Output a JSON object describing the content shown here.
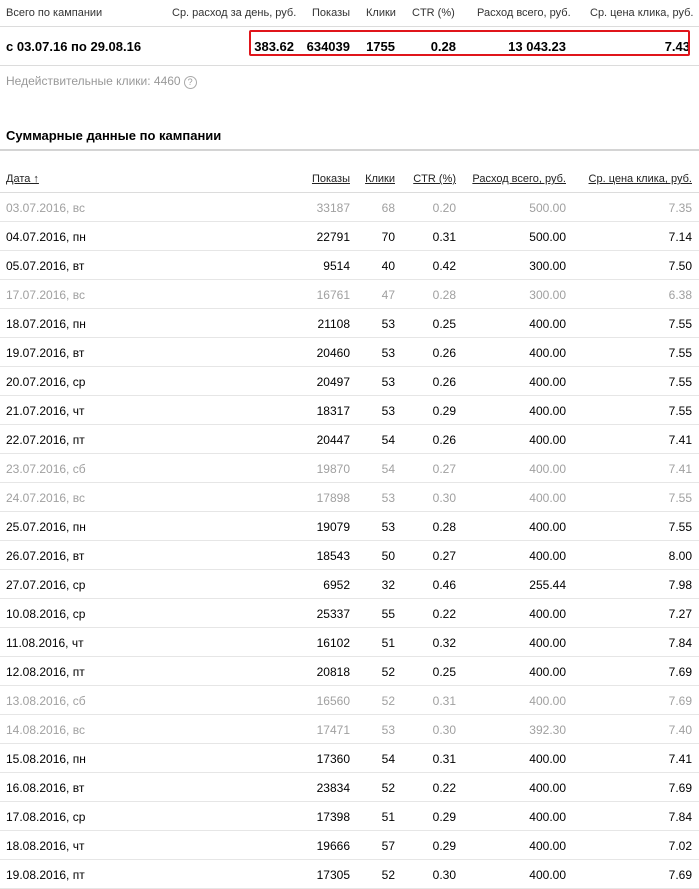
{
  "summary": {
    "headers": {
      "campaign": "Всего по кампании",
      "avg_daily": "Ср. расход за день, руб.",
      "shows": "Показы",
      "clicks": "Клики",
      "ctr": "CTR (%)",
      "spend": "Расход всего, руб.",
      "cpc": "Ср. цена клика, руб."
    },
    "period": "с 03.07.16 по 29.08.16",
    "avg_daily": "383.62",
    "shows": "634039",
    "clicks": "1755",
    "ctr": "0.28",
    "spend": "13 043.23",
    "cpc": "7.43",
    "highlight_color": "#e0151b"
  },
  "invalid_clicks": "Недействительные клики: 4460",
  "help_icon": "?",
  "section_title": "Суммарные данные по кампании",
  "daily": {
    "headers": {
      "date": "Дата ↑",
      "shows": "Показы",
      "clicks": "Клики",
      "ctr": "CTR (%)",
      "spend": "Расход всего, руб.",
      "cpc": "Ср. цена клика, руб."
    },
    "rows": [
      {
        "date": "03.07.2016, вс",
        "shows": "33187",
        "clicks": "68",
        "ctr": "0.20",
        "spend": "500.00",
        "cpc": "7.35",
        "weekend": true
      },
      {
        "date": "04.07.2016, пн",
        "shows": "22791",
        "clicks": "70",
        "ctr": "0.31",
        "spend": "500.00",
        "cpc": "7.14",
        "weekend": false
      },
      {
        "date": "05.07.2016, вт",
        "shows": "9514",
        "clicks": "40",
        "ctr": "0.42",
        "spend": "300.00",
        "cpc": "7.50",
        "weekend": false
      },
      {
        "date": "17.07.2016, вс",
        "shows": "16761",
        "clicks": "47",
        "ctr": "0.28",
        "spend": "300.00",
        "cpc": "6.38",
        "weekend": true
      },
      {
        "date": "18.07.2016, пн",
        "shows": "21108",
        "clicks": "53",
        "ctr": "0.25",
        "spend": "400.00",
        "cpc": "7.55",
        "weekend": false
      },
      {
        "date": "19.07.2016, вт",
        "shows": "20460",
        "clicks": "53",
        "ctr": "0.26",
        "spend": "400.00",
        "cpc": "7.55",
        "weekend": false
      },
      {
        "date": "20.07.2016, ср",
        "shows": "20497",
        "clicks": "53",
        "ctr": "0.26",
        "spend": "400.00",
        "cpc": "7.55",
        "weekend": false
      },
      {
        "date": "21.07.2016, чт",
        "shows": "18317",
        "clicks": "53",
        "ctr": "0.29",
        "spend": "400.00",
        "cpc": "7.55",
        "weekend": false
      },
      {
        "date": "22.07.2016, пт",
        "shows": "20447",
        "clicks": "54",
        "ctr": "0.26",
        "spend": "400.00",
        "cpc": "7.41",
        "weekend": false
      },
      {
        "date": "23.07.2016, сб",
        "shows": "19870",
        "clicks": "54",
        "ctr": "0.27",
        "spend": "400.00",
        "cpc": "7.41",
        "weekend": true
      },
      {
        "date": "24.07.2016, вс",
        "shows": "17898",
        "clicks": "53",
        "ctr": "0.30",
        "spend": "400.00",
        "cpc": "7.55",
        "weekend": true
      },
      {
        "date": "25.07.2016, пн",
        "shows": "19079",
        "clicks": "53",
        "ctr": "0.28",
        "spend": "400.00",
        "cpc": "7.55",
        "weekend": false
      },
      {
        "date": "26.07.2016, вт",
        "shows": "18543",
        "clicks": "50",
        "ctr": "0.27",
        "spend": "400.00",
        "cpc": "8.00",
        "weekend": false
      },
      {
        "date": "27.07.2016, ср",
        "shows": "6952",
        "clicks": "32",
        "ctr": "0.46",
        "spend": "255.44",
        "cpc": "7.98",
        "weekend": false
      },
      {
        "date": "10.08.2016, ср",
        "shows": "25337",
        "clicks": "55",
        "ctr": "0.22",
        "spend": "400.00",
        "cpc": "7.27",
        "weekend": false
      },
      {
        "date": "11.08.2016, чт",
        "shows": "16102",
        "clicks": "51",
        "ctr": "0.32",
        "spend": "400.00",
        "cpc": "7.84",
        "weekend": false
      },
      {
        "date": "12.08.2016, пт",
        "shows": "20818",
        "clicks": "52",
        "ctr": "0.25",
        "spend": "400.00",
        "cpc": "7.69",
        "weekend": false
      },
      {
        "date": "13.08.2016, сб",
        "shows": "16560",
        "clicks": "52",
        "ctr": "0.31",
        "spend": "400.00",
        "cpc": "7.69",
        "weekend": true
      },
      {
        "date": "14.08.2016, вс",
        "shows": "17471",
        "clicks": "53",
        "ctr": "0.30",
        "spend": "392.30",
        "cpc": "7.40",
        "weekend": true
      },
      {
        "date": "15.08.2016, пн",
        "shows": "17360",
        "clicks": "54",
        "ctr": "0.31",
        "spend": "400.00",
        "cpc": "7.41",
        "weekend": false
      },
      {
        "date": "16.08.2016, вт",
        "shows": "23834",
        "clicks": "52",
        "ctr": "0.22",
        "spend": "400.00",
        "cpc": "7.69",
        "weekend": false
      },
      {
        "date": "17.08.2016, ср",
        "shows": "17398",
        "clicks": "51",
        "ctr": "0.29",
        "spend": "400.00",
        "cpc": "7.84",
        "weekend": false
      },
      {
        "date": "18.08.2016, чт",
        "shows": "19666",
        "clicks": "57",
        "ctr": "0.29",
        "spend": "400.00",
        "cpc": "7.02",
        "weekend": false
      },
      {
        "date": "19.08.2016, пт",
        "shows": "17305",
        "clicks": "52",
        "ctr": "0.30",
        "spend": "400.00",
        "cpc": "7.69",
        "weekend": false
      }
    ]
  }
}
